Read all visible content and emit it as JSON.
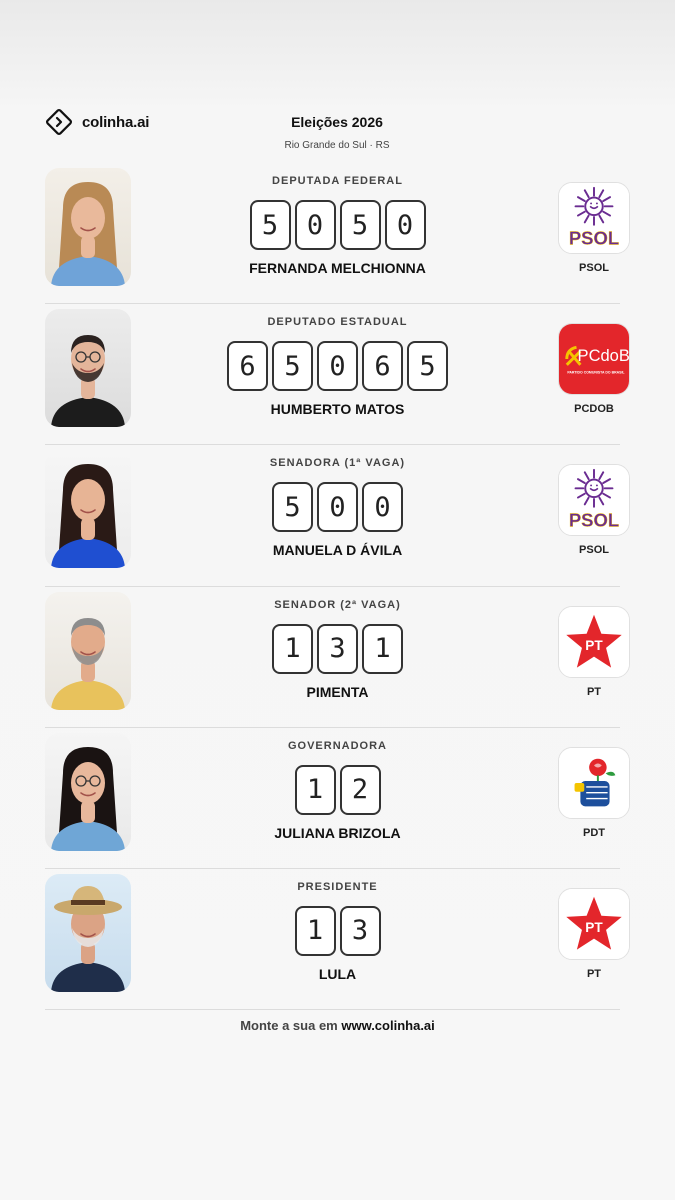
{
  "header": {
    "brand": "colinha.ai",
    "title": "Eleições 2026",
    "subtitle": "Rio Grande do Sul · RS"
  },
  "candidates": [
    {
      "office": "DEPUTADA FEDERAL",
      "number": "5050",
      "name": "FERNANDA MELCHIONNA",
      "party": "PSOL",
      "party_logo": "psol-logo",
      "photo": "candidate-photo"
    },
    {
      "office": "DEPUTADO ESTADUAL",
      "number": "65065",
      "name": "HUMBERTO MATOS",
      "party": "PCDOB",
      "party_logo": "pcdob-logo",
      "photo": "candidate-photo",
      "party_logo_text": "PCdoB",
      "party_logo_subtext": "PARTIDO COMUNISTA DO BRASIL"
    },
    {
      "office": "SENADORA (1ª VAGA)",
      "number": "500",
      "name": "MANUELA D ÁVILA",
      "party": "PSOL",
      "party_logo": "psol-logo",
      "photo": "candidate-photo"
    },
    {
      "office": "SENADOR (2ª VAGA)",
      "number": "131",
      "name": "PIMENTA",
      "party": "PT",
      "party_logo": "pt-logo",
      "photo": "candidate-photo"
    },
    {
      "office": "GOVERNADORA",
      "number": "12",
      "name": "JULIANA BRIZOLA",
      "party": "PDT",
      "party_logo": "pdt-logo",
      "photo": "candidate-photo"
    },
    {
      "office": "PRESIDENTE",
      "number": "13",
      "name": "LULA",
      "party": "PT",
      "party_logo": "pt-logo",
      "photo": "candidate-photo"
    }
  ],
  "footer": {
    "prefix": "Monte a sua em ",
    "link": "www.colinha.ai"
  },
  "colors": {
    "psol_purple": "#6a2c91",
    "psol_yellow": "#f4c400",
    "pcdob_red": "#e3262b",
    "pt_red": "#e3262b",
    "pdt_blue": "#1d4f9c",
    "pdt_red": "#e3262b"
  }
}
